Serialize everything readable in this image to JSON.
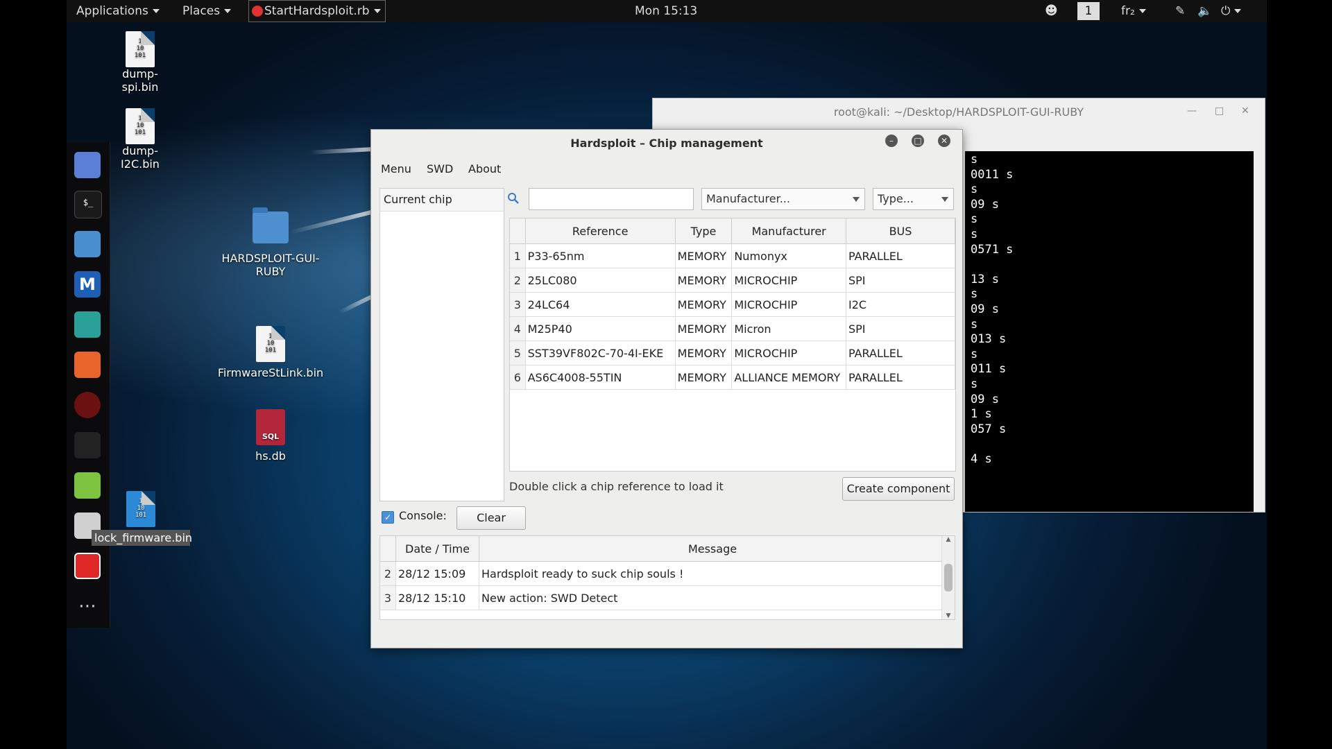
{
  "topbar": {
    "applications": "Applications",
    "places": "Places",
    "active_app": "StartHardsploit.rb",
    "clock": "Mon 15:13",
    "workspace": "1",
    "keyboard": "fr₂"
  },
  "desktop_icons": {
    "dump_spi": "dump-spi.bin",
    "dump_i2c": "dump-I2C.bin",
    "folder_line1": "HARDSPLOIT-GUI-",
    "folder_line2": "RUBY",
    "firmware": "FirmwareStLink.bin",
    "db": "hs.db",
    "db_badge": "SQL",
    "lock_firmware": "lock_firmware.bin"
  },
  "terminal": {
    "title": "root@kali: ~/Desktop/HARDSPLOIT-GUI-RUBY",
    "lines": [
      "s",
      "0011 s",
      "s",
      "09 s",
      "s",
      "s",
      "0571 s",
      "",
      "13 s",
      "s",
      "09 s",
      "s",
      "013 s",
      "s",
      "011 s",
      "s",
      "09 s",
      "1 s",
      "057 s",
      "",
      "4 s"
    ]
  },
  "window": {
    "title": "Hardsploit – Chip management",
    "menu": [
      "Menu",
      "SWD",
      "About"
    ],
    "current_chip_header": "Current chip",
    "search_value": "",
    "manufacturer_combo": "Manufacturer...",
    "type_combo": "Type...",
    "chip_columns": [
      "Reference",
      "Type",
      "Manufacturer",
      "BUS"
    ],
    "chip_rows": [
      {
        "n": "1",
        "ref": "P33-65nm",
        "type": "MEMORY",
        "mfr": "Numonyx",
        "bus": "PARALLEL"
      },
      {
        "n": "2",
        "ref": "25LC080",
        "type": "MEMORY",
        "mfr": "MICROCHIP",
        "bus": "SPI"
      },
      {
        "n": "3",
        "ref": "24LC64",
        "type": "MEMORY",
        "mfr": "MICROCHIP",
        "bus": "I2C"
      },
      {
        "n": "4",
        "ref": "M25P40",
        "type": "MEMORY",
        "mfr": "Micron",
        "bus": "SPI"
      },
      {
        "n": "5",
        "ref": "SST39VF802C-70-4I-EKE",
        "type": "MEMORY",
        "mfr": "MICROCHIP",
        "bus": "PARALLEL"
      },
      {
        "n": "6",
        "ref": "AS6C4008-55TIN",
        "type": "MEMORY",
        "mfr": "ALLIANCE MEMORY",
        "bus": "PARALLEL"
      }
    ],
    "hint": "Double click a chip reference to load it",
    "create_button": "Create component",
    "console_label": "Console:",
    "console_checked": true,
    "clear_button": "Clear",
    "log_columns": [
      "Date / Time",
      "Message"
    ],
    "log_rows": [
      {
        "n": "2",
        "time": "28/12 15:09",
        "msg": "Hardsploit ready to suck chip souls !"
      },
      {
        "n": "3",
        "time": "28/12 15:10",
        "msg": "New action: SWD Detect"
      }
    ]
  },
  "colors": {
    "accent": "#4a90d9",
    "desktop": "#0a3d66"
  }
}
